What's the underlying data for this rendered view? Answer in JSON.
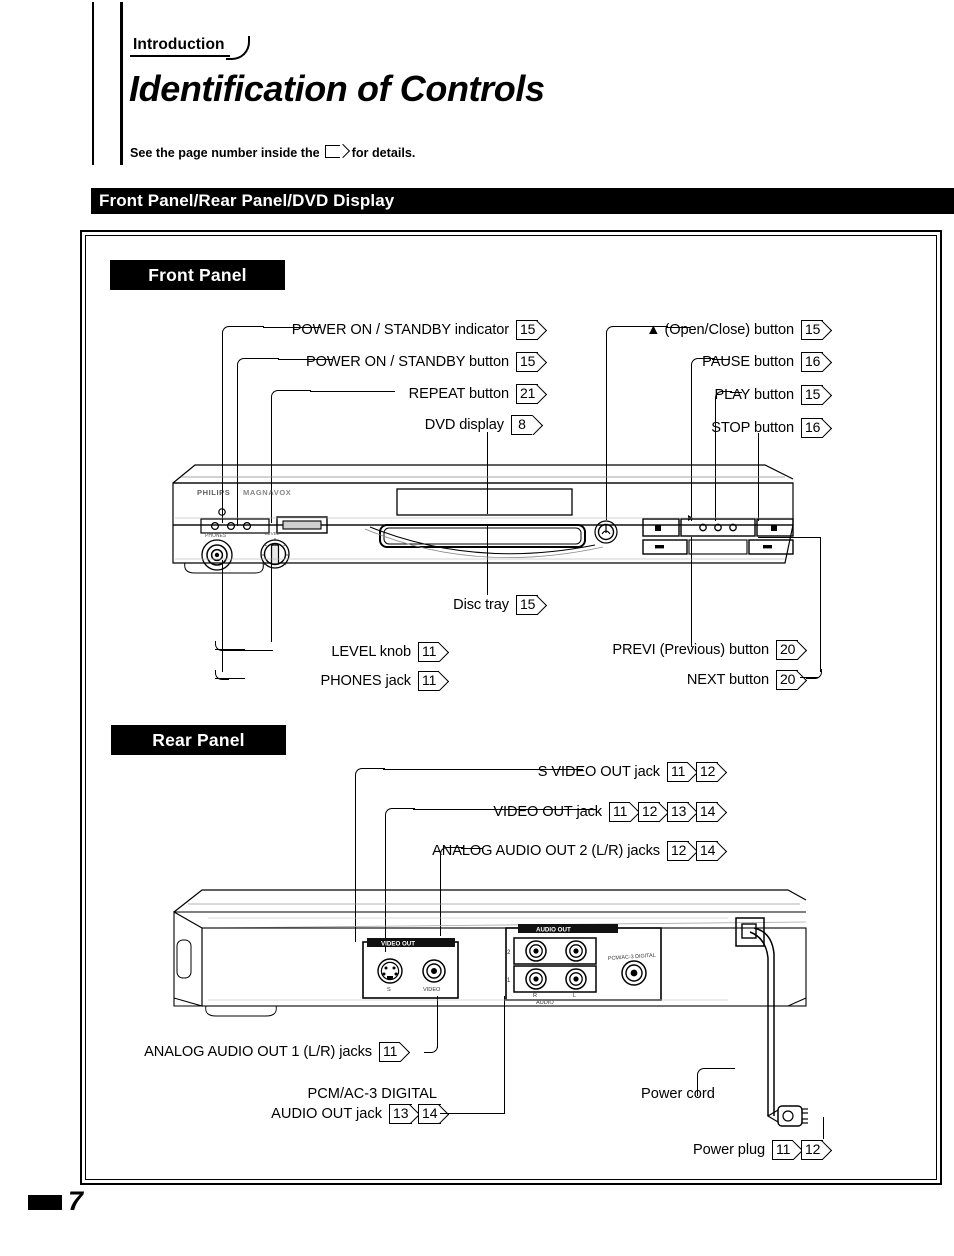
{
  "header": {
    "tab_label": "Introduction",
    "title": "Identification of Controls",
    "note_prefix": "See the page number inside the",
    "note_suffix": "for details.",
    "section_bar": "Front Panel/Rear Panel/DVD Display"
  },
  "panels": {
    "front_label": "Front Panel",
    "rear_label": "Rear Panel"
  },
  "front_panel_callouts": {
    "left": [
      {
        "label": "POWER ON / STANDBY indicator",
        "pages": [
          "15"
        ]
      },
      {
        "label": "POWER ON / STANDBY button",
        "pages": [
          "15"
        ]
      },
      {
        "label": "REPEAT button",
        "pages": [
          "21"
        ]
      },
      {
        "label": "DVD display",
        "pages": [
          "8"
        ]
      },
      {
        "label": "Disc tray",
        "pages": [
          "15"
        ]
      },
      {
        "label": "LEVEL knob",
        "pages": [
          "11"
        ]
      },
      {
        "label": "PHONES jack",
        "pages": [
          "11"
        ]
      }
    ],
    "right": [
      {
        "label": "▲ (Open/Close) button",
        "pages": [
          "15"
        ]
      },
      {
        "label": "PAUSE  button",
        "pages": [
          "16"
        ]
      },
      {
        "label": "PLAY button",
        "pages": [
          "15"
        ]
      },
      {
        "label": "STOP button",
        "pages": [
          "16"
        ]
      },
      {
        "label": "PREVI (Previous) button",
        "pages": [
          "20"
        ]
      },
      {
        "label": "NEXT button",
        "pages": [
          "20"
        ]
      }
    ]
  },
  "rear_panel_callouts": [
    {
      "label": "S VIDEO OUT jack",
      "pages": [
        "11",
        "12"
      ]
    },
    {
      "label": "VIDEO OUT jack",
      "pages": [
        "11",
        "12",
        "13",
        "14"
      ]
    },
    {
      "label": "ANALOG AUDIO OUT 2 (L/R) jacks",
      "pages": [
        "12",
        "14"
      ]
    },
    {
      "label": "ANALOG AUDIO OUT 1 (L/R) jacks",
      "pages": [
        "11"
      ]
    },
    {
      "label": "PCM/AC-3 DIGITAL",
      "label_line2": "AUDIO OUT jack",
      "pages": [
        "13",
        "14"
      ]
    },
    {
      "label": "Power cord",
      "pages": []
    },
    {
      "label": "Power plug",
      "pages": [
        "11",
        "12"
      ]
    }
  ],
  "device_markings": {
    "brand": "PHILIPS MAGNAVOX",
    "phones": "PHONES",
    "level": "LEVEL",
    "rear_video_out": "VIDEO OUT",
    "rear_audio_out": "AUDIO OUT",
    "rear_s_label": "S",
    "rear_video_label": "VIDEO",
    "rear_audio_label": "AUDIO",
    "rear_lr_l": "L",
    "rear_lr_r": "R",
    "rear_ch_1": "1",
    "rear_ch_2": "2",
    "rear_digital": "PCM/AC-3 DIGITAL"
  },
  "footer": {
    "page_number": "7"
  }
}
